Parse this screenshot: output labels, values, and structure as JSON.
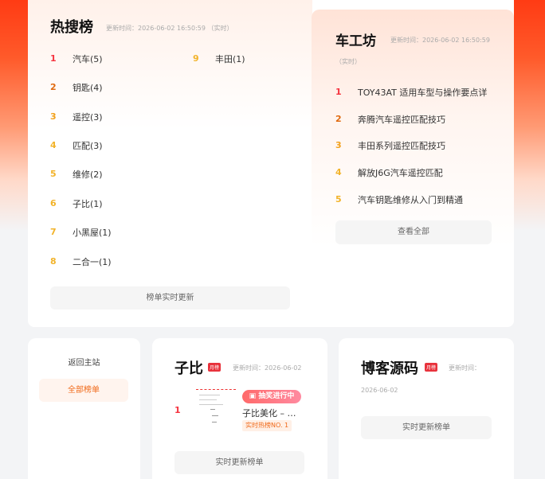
{
  "hot_list": {
    "title": "热搜榜",
    "meta": "更新时间：2026-06-02 16:50:59 （实时）",
    "items": [
      {
        "rank": "1",
        "label": "汽车(5)"
      },
      {
        "rank": "2",
        "label": "钥匙(4)"
      },
      {
        "rank": "3",
        "label": "遥控(3)"
      },
      {
        "rank": "4",
        "label": "匹配(3)"
      },
      {
        "rank": "5",
        "label": "维修(2)"
      },
      {
        "rank": "6",
        "label": "子比(1)"
      },
      {
        "rank": "7",
        "label": "小黑屋(1)"
      },
      {
        "rank": "8",
        "label": "二合一(1)"
      },
      {
        "rank": "9",
        "label": "丰田(1)"
      }
    ],
    "button": "榜单实时更新"
  },
  "car_workshop": {
    "title": "车工坊",
    "meta_time": "更新时间：2026-06-02 16:50:59",
    "meta_realtime": "（实时）",
    "items": [
      {
        "rank": "1",
        "label": "TOY43AT 适用车型与操作要点详"
      },
      {
        "rank": "2",
        "label": "奔腾汽车遥控匹配技巧"
      },
      {
        "rank": "3",
        "label": "丰田系列遥控匹配技巧"
      },
      {
        "rank": "4",
        "label": "解放J6G汽车遥控匹配"
      },
      {
        "rank": "5",
        "label": "汽车钥匙维修从入门到精通"
      }
    ],
    "button": "查看全部"
  },
  "left_nav": {
    "back": "返回主站",
    "all_lists": "全部榜单"
  },
  "zibi": {
    "title": "子比",
    "badge": "月榜",
    "meta": "更新时间：2026-06-02",
    "item_rank": "1",
    "lottery": "抽奖进行中",
    "item_title": "子比美化 – …",
    "hot_tag": "实时热榜NO. 1",
    "button": "实时更新榜单"
  },
  "boke": {
    "title": "博客源码",
    "badge": "月榜",
    "meta_label": "更新时间：",
    "meta_date": "2026-06-02",
    "button": "实时更新榜单"
  },
  "colors": {
    "accent_red": "#f5333f",
    "accent_orange": "#e06a10",
    "accent_gold": "#f2a11c",
    "hero_gradient_top": "#ff3b14"
  }
}
